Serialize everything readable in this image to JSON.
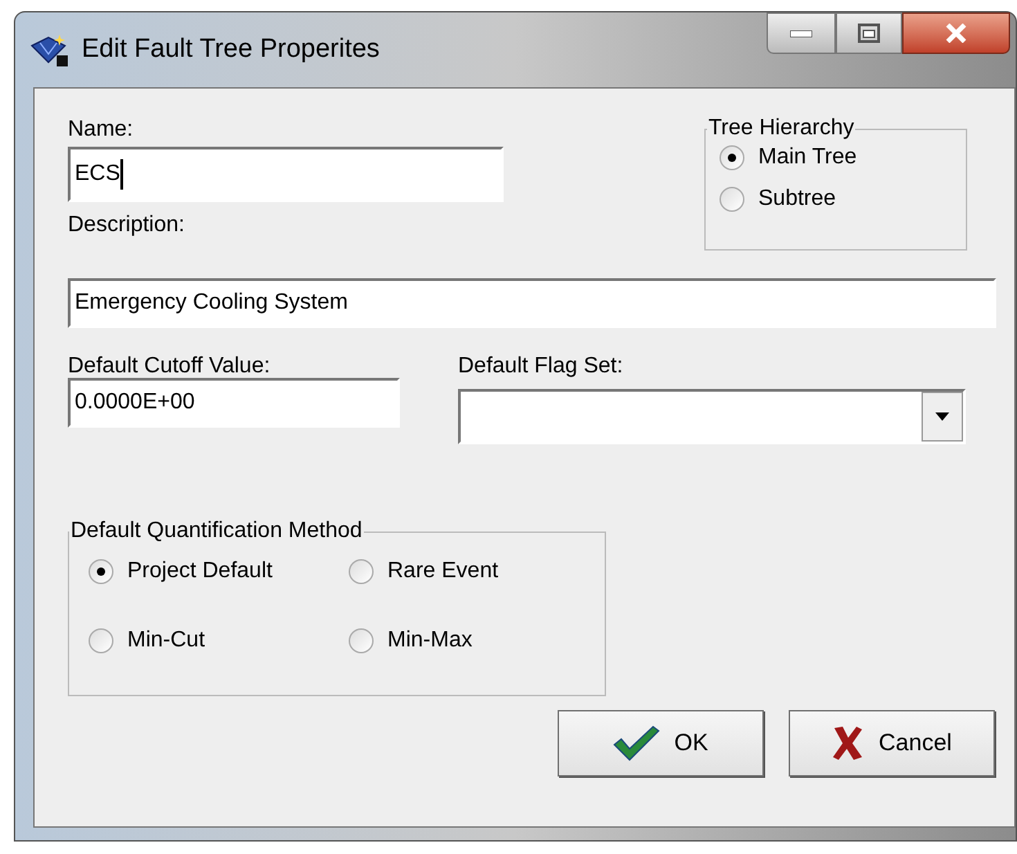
{
  "window": {
    "title": "Edit Fault Tree Properites"
  },
  "name": {
    "label": "Name:",
    "value": "ECS"
  },
  "tree_hierarchy": {
    "title": "Tree Hierarchy",
    "options": [
      {
        "label": "Main Tree",
        "selected": true
      },
      {
        "label": "Subtree",
        "selected": false
      }
    ]
  },
  "description": {
    "label": "Description:",
    "value": "Emergency Cooling System"
  },
  "cutoff": {
    "label": "Default Cutoff Value:",
    "value": "0.0000E+00"
  },
  "flag_set": {
    "label": "Default Flag Set:"
  },
  "quantification": {
    "title": "Default Quantification Method",
    "options": [
      {
        "label": "Project Default",
        "selected": true
      },
      {
        "label": "Rare Event",
        "selected": false
      },
      {
        "label": "Min-Cut",
        "selected": false
      },
      {
        "label": "Min-Max",
        "selected": false
      }
    ]
  },
  "buttons": [
    {
      "kind": "ok",
      "label": "OK"
    },
    {
      "kind": "cancel",
      "label": "Cancel"
    }
  ]
}
